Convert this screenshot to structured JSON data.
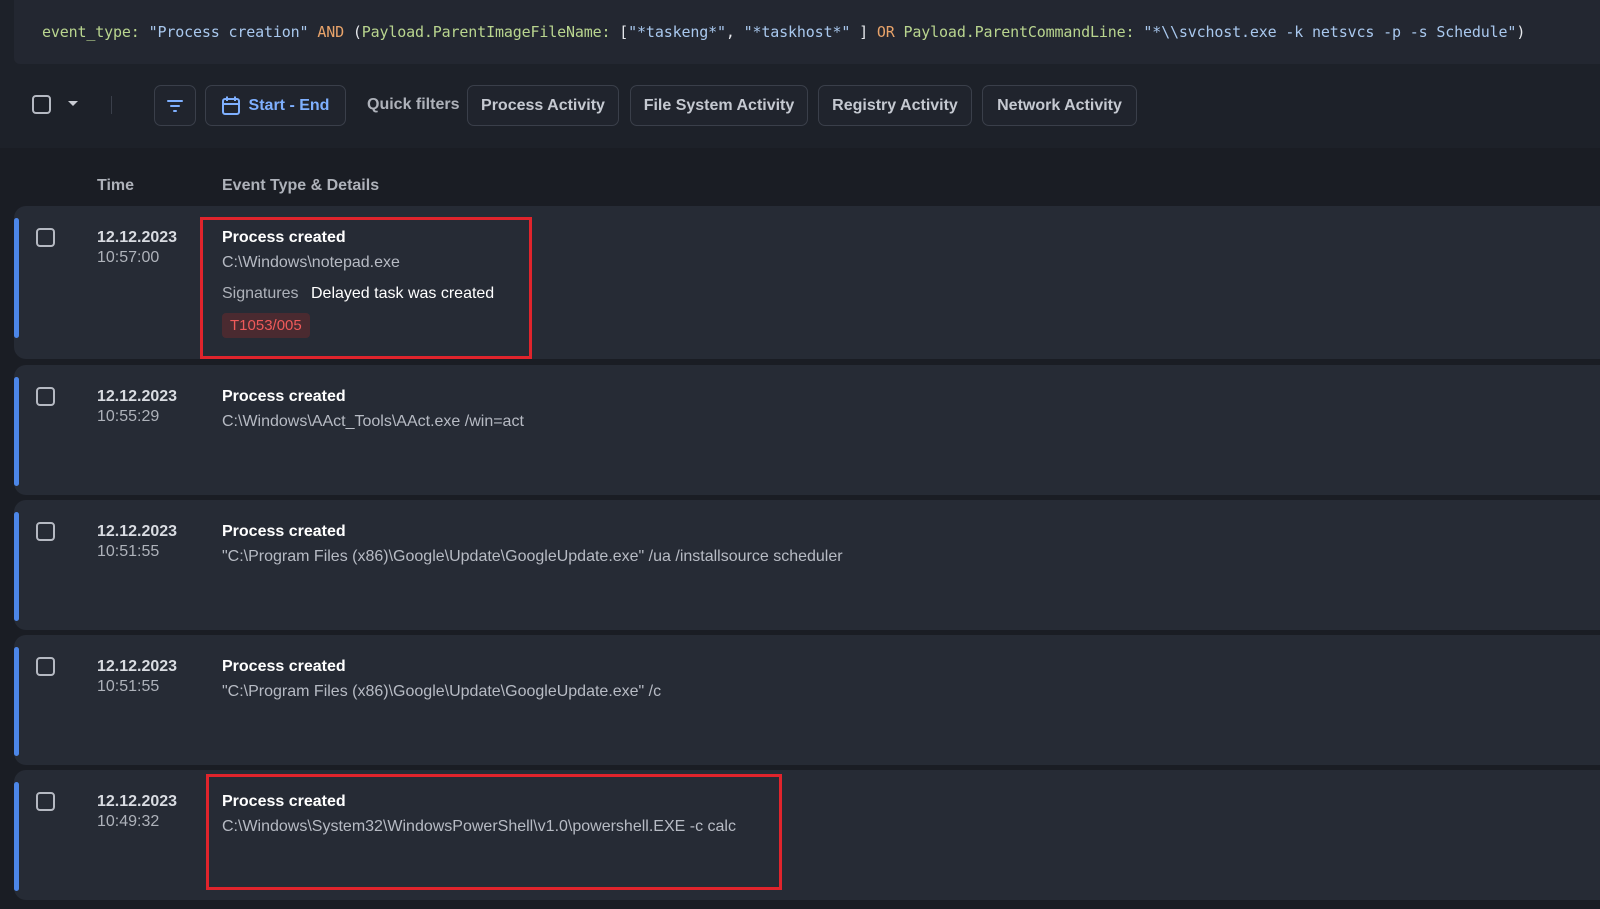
{
  "query": {
    "tokens": [
      {
        "text": "event_type: ",
        "kind": "key"
      },
      {
        "text": "\"Process creation\"",
        "kind": "str"
      },
      {
        "text": " AND ",
        "kind": "op"
      },
      {
        "text": "(",
        "kind": "pun"
      },
      {
        "text": "Payload.ParentImageFileName: ",
        "kind": "key"
      },
      {
        "text": "[",
        "kind": "pun"
      },
      {
        "text": "\"*taskeng*\"",
        "kind": "str"
      },
      {
        "text": ", ",
        "kind": "pun"
      },
      {
        "text": "\"*taskhost*\"",
        "kind": "str"
      },
      {
        "text": " ] ",
        "kind": "pun"
      },
      {
        "text": "OR ",
        "kind": "op"
      },
      {
        "text": "Payload.ParentCommandLine: ",
        "kind": "key"
      },
      {
        "text": "\"*\\\\svchost.exe -k netsvcs -p -s Schedule\"",
        "kind": "str"
      },
      {
        "text": ")",
        "kind": "pun"
      }
    ]
  },
  "toolbar": {
    "date_range_label": "Start - End",
    "quick_filters_label": "Quick filters",
    "quick_filters": [
      "Process Activity",
      "File System Activity",
      "Registry Activity",
      "Network Activity"
    ],
    "icons": {
      "filter": "filter-icon",
      "calendar": "calendar-icon",
      "dropdown": "chevron-down-icon"
    }
  },
  "table": {
    "headers": {
      "time": "Time",
      "details": "Event Type & Details"
    },
    "events": [
      {
        "date": "12.12.2023",
        "time": "10:57:00",
        "type": "Process created",
        "command": "C:\\Windows\\notepad.exe",
        "signatures_label": "Signatures",
        "signature": "Delayed task was created",
        "tag": "T1053/005",
        "highlighted": true
      },
      {
        "date": "12.12.2023",
        "time": "10:55:29",
        "type": "Process created",
        "command": "C:\\Windows\\AAct_Tools\\AAct.exe /win=act",
        "highlighted": false
      },
      {
        "date": "12.12.2023",
        "time": "10:51:55",
        "type": "Process created",
        "command": "\"C:\\Program Files (x86)\\Google\\Update\\GoogleUpdate.exe\" /ua /installsource scheduler",
        "highlighted": false
      },
      {
        "date": "12.12.2023",
        "time": "10:51:55",
        "type": "Process created",
        "command": "\"C:\\Program Files (x86)\\Google\\Update\\GoogleUpdate.exe\" /c",
        "highlighted": false
      },
      {
        "date": "12.12.2023",
        "time": "10:49:32",
        "type": "Process created",
        "command": "C:\\Windows\\System32\\WindowsPowerShell\\v1.0\\powershell.EXE -c calc",
        "highlighted": true
      }
    ]
  },
  "colors": {
    "accent": "#4c86e8",
    "highlight_box": "#e0242c",
    "tag_text": "#ef5a5a",
    "tag_bg": "#4a2a30",
    "background": "#1d2129",
    "card": "#262b35"
  }
}
